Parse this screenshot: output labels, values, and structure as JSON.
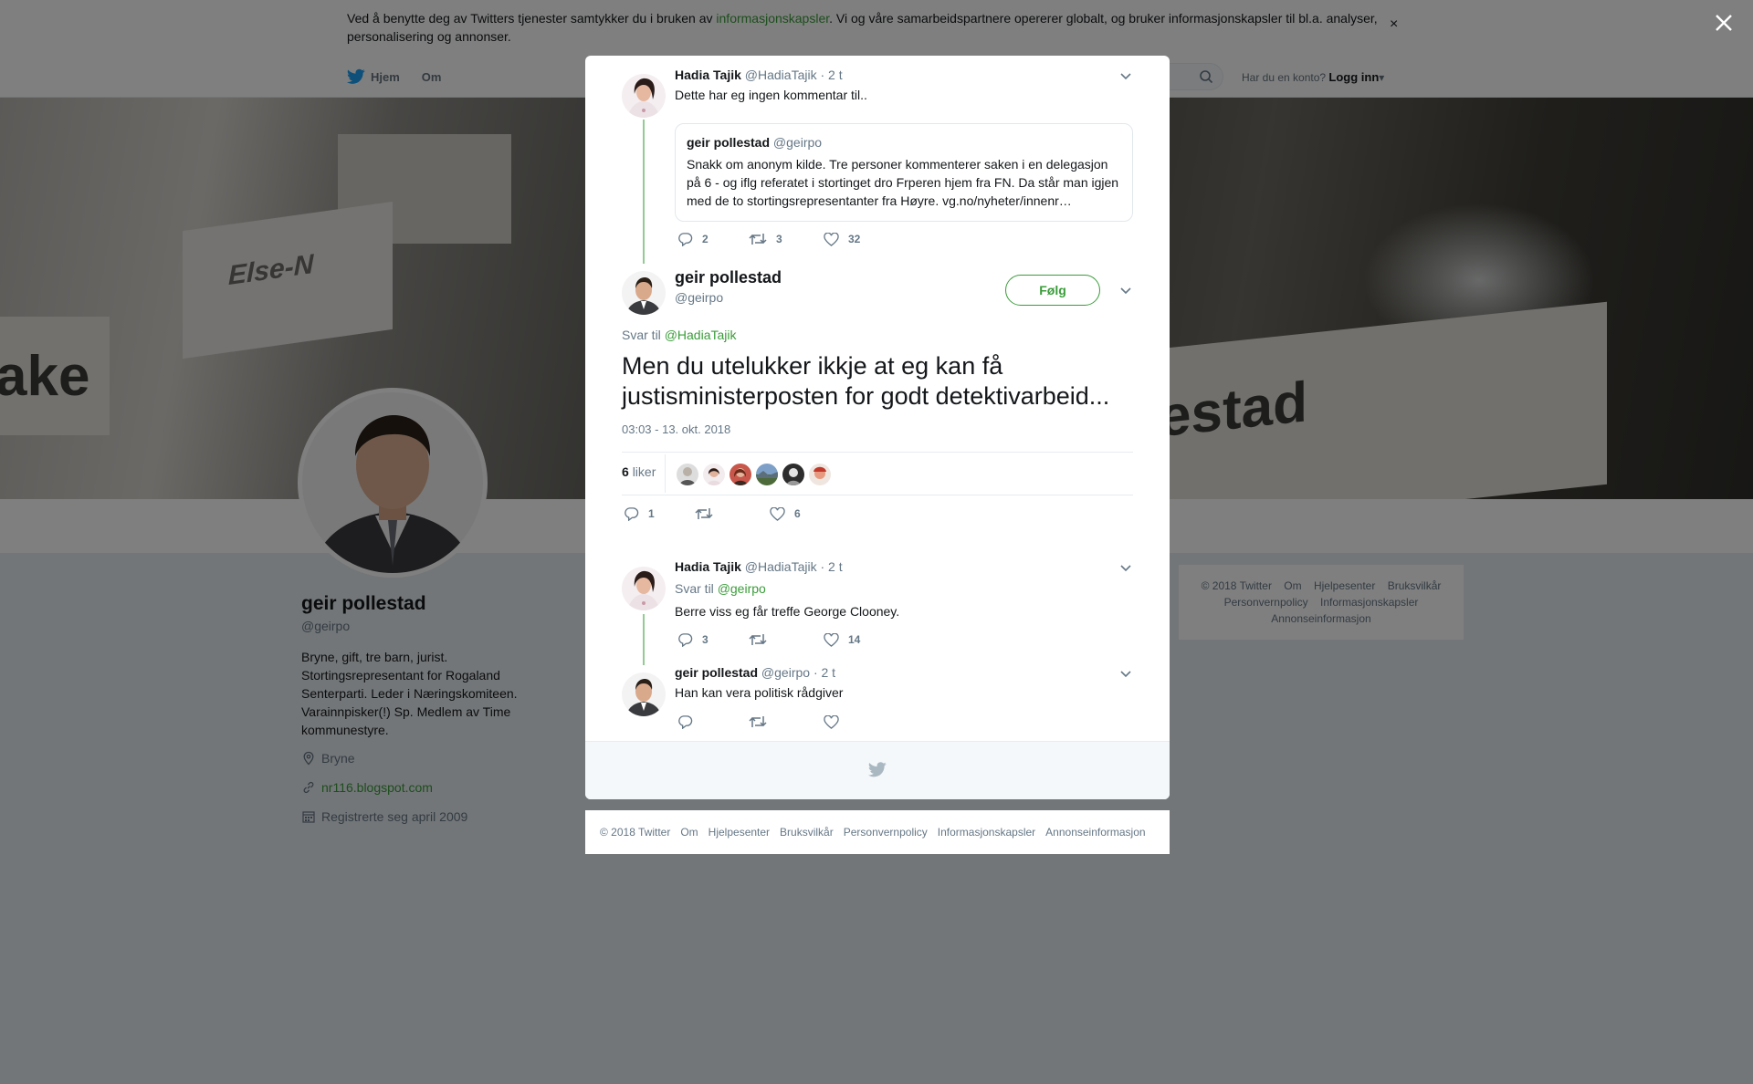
{
  "cookie_bar": {
    "text_before": "Ved å benytte deg av Twitters tjenester samtykker du i bruken av ",
    "link": "informasjonskapsler",
    "text_after": ". Vi og våre samarbeidspartnere opererer globalt, og bruker informasjonskapsler til bl.a. analyser, personalisering og annonser.",
    "close": "×"
  },
  "nav": {
    "home": "Hjem",
    "about": "Om",
    "have_account": "Har du en konto?",
    "login": "Logg inn"
  },
  "cover": {
    "sign_left": "Else-N",
    "sign_right": "estad",
    "sign_far_left": "ake"
  },
  "profile": {
    "name": "geir pollestad",
    "handle": "@geirpo",
    "bio": "Bryne, gift, tre barn, jurist. Stortingsrepresentant for Rogaland Senterparti. Leder i Næringskomiteen. Varainnpisker(!) Sp. Medlem av Time kommunestyre.",
    "location": "Bryne",
    "website": "nr116.blogspot.com",
    "joined": "Registrerte seg april 2009"
  },
  "side_footer": {
    "items": [
      "© 2018 Twitter",
      "Om",
      "Hjelpesenter",
      "Bruksvilkår",
      "Personvernpolicy",
      "Informasjonskapsler",
      "Annonseinformasjon"
    ]
  },
  "modal": {
    "tweet1": {
      "name": "Hadia Tajik",
      "handle": "@HadiaTajik",
      "time": "· 2 t",
      "text": "Dette har eg ingen kommentar til..",
      "quote": {
        "name": "geir pollestad",
        "handle": "@geirpo",
        "text": "Snakk om anonym kilde. Tre personer kommenterer saken i en delegasjon på 6 - og iflg referatet i stortinget dro Frperen hjem fra FN. Da står man igjen med de to stortingsrepresentanter fra Høyre. vg.no/nyheter/innenr…"
      },
      "replies": "2",
      "retweets": "3",
      "likes": "32"
    },
    "main": {
      "name": "geir pollestad",
      "handle": "@geirpo",
      "follow": "Følg",
      "reply_to_label": "Svar til",
      "reply_to": "@HadiaTajik",
      "text": "Men du utelukker ikkje at eg kan få justisministerposten for godt detektivarbeid...",
      "timestamp": "03:03 - 13. okt. 2018",
      "likes_count": "6",
      "likes_label": "liker",
      "replies": "1",
      "retweets": "",
      "likes": "6"
    },
    "reply1": {
      "name": "Hadia Tajik",
      "handle": "@HadiaTajik",
      "time": "· 2 t",
      "reply_to_label": "Svar til",
      "reply_to": "@geirpo",
      "text": "Berre viss eg får treffe George Clooney.",
      "replies": "3",
      "retweets": "",
      "likes": "14"
    },
    "reply2": {
      "name": "geir pollestad",
      "handle": "@geirpo",
      "time": "· 2 t",
      "text": "Han kan vera politisk rådgiver"
    }
  },
  "bottom_footer": {
    "items": [
      "© 2018 Twitter",
      "Om",
      "Hjelpesenter",
      "Bruksvilkår",
      "Personvernpolicy",
      "Informasjonskapsler",
      "Annonseinformasjon"
    ]
  },
  "colors": {
    "accent": "#3a9c3a",
    "twitter_blue": "#1da1f2",
    "overlay": "rgba(0,0,0,0.5)"
  }
}
